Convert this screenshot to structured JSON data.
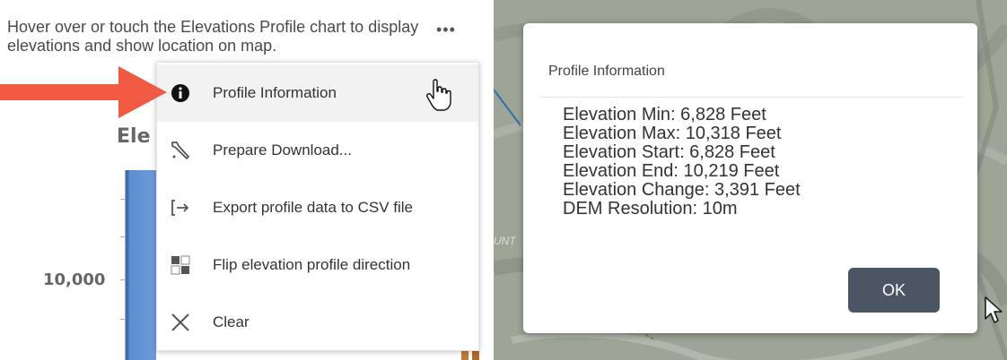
{
  "left": {
    "instructions": "Hover over or touch the Elevations Profile chart to display elevations and show location on map.",
    "more_icon": "•••",
    "chart_title_fragment": "Ele",
    "y_tick_label": "10,000"
  },
  "menu": {
    "items": [
      {
        "label": "Profile Information",
        "icon": "info-icon"
      },
      {
        "label": "Prepare Download...",
        "icon": "wrench-icon"
      },
      {
        "label": "Export profile data to CSV file",
        "icon": "export-icon"
      },
      {
        "label": "Flip elevation profile direction",
        "icon": "flip-icon"
      },
      {
        "label": "Clear",
        "icon": "close-icon"
      }
    ]
  },
  "map": {
    "label_fragment": "UNT"
  },
  "dialog": {
    "title": "Profile Information",
    "info": [
      "Elevation Min: 6,828 Feet",
      "Elevation Max: 10,318 Feet",
      "Elevation Start: 6,828 Feet",
      "Elevation End: 10,219 Feet",
      "Elevation Change: 3,391 Feet",
      "DEM Resolution: 10m"
    ],
    "ok_label": "OK"
  },
  "colors": {
    "arrow": "#f15a42",
    "button": "#4b5563",
    "chart_fill": "#6c9cd8"
  }
}
